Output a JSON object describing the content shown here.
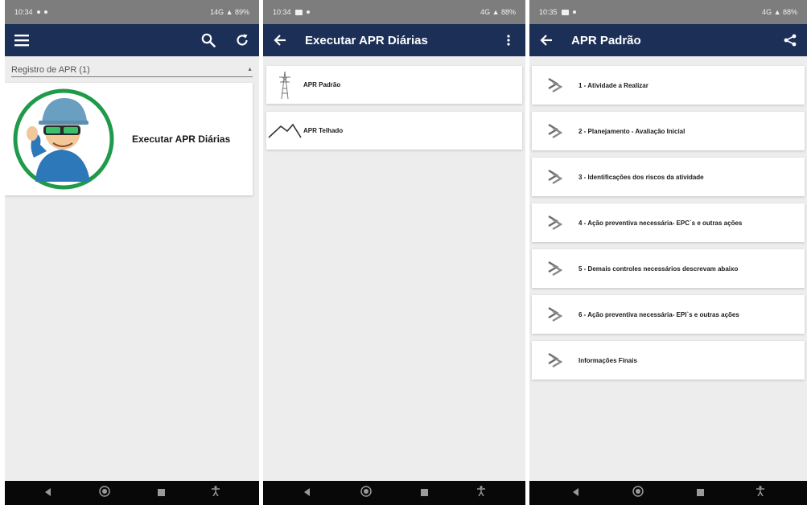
{
  "status_bars": {
    "p1": {
      "time": "10:34",
      "right": "14G ▲ 89%"
    },
    "p2": {
      "time": "10:34",
      "right": "4G ▲ 88%"
    },
    "p3": {
      "time": "10:35",
      "right": "4G ▲ 88%"
    }
  },
  "screen1": {
    "dropdown_label": "Registro de APR (1)",
    "card_label": "Executar APR Diárias",
    "icons": [
      "menu-icon",
      "search-icon",
      "refresh-icon"
    ]
  },
  "screen2": {
    "title": "Executar APR Diárias",
    "items": [
      {
        "label": "APR Padrão",
        "icon": "tower-icon"
      },
      {
        "label": "APR Telhado",
        "icon": "roof-icon"
      }
    ]
  },
  "screen3": {
    "title": "APR Padrão",
    "items": [
      {
        "label": "1 - Atividade a Realizar"
      },
      {
        "label": "2 - Planejamento - Avaliação Inicial"
      },
      {
        "label": "3 - Identificações dos riscos da atividade"
      },
      {
        "label": "4 - Ação preventiva necessária- EPC`s e outras ações"
      },
      {
        "label": "5 - Demais controles necessários descrevam abaixo"
      },
      {
        "label": "6 - Ação preventiva necessária- EPI`s e outras ações"
      },
      {
        "label": "Informações Finais"
      }
    ]
  },
  "colors": {
    "appbar": "#1b2f57",
    "background": "#ededed",
    "card": "#ffffff",
    "navbar": "#080808",
    "status": "#7d7d7d"
  }
}
